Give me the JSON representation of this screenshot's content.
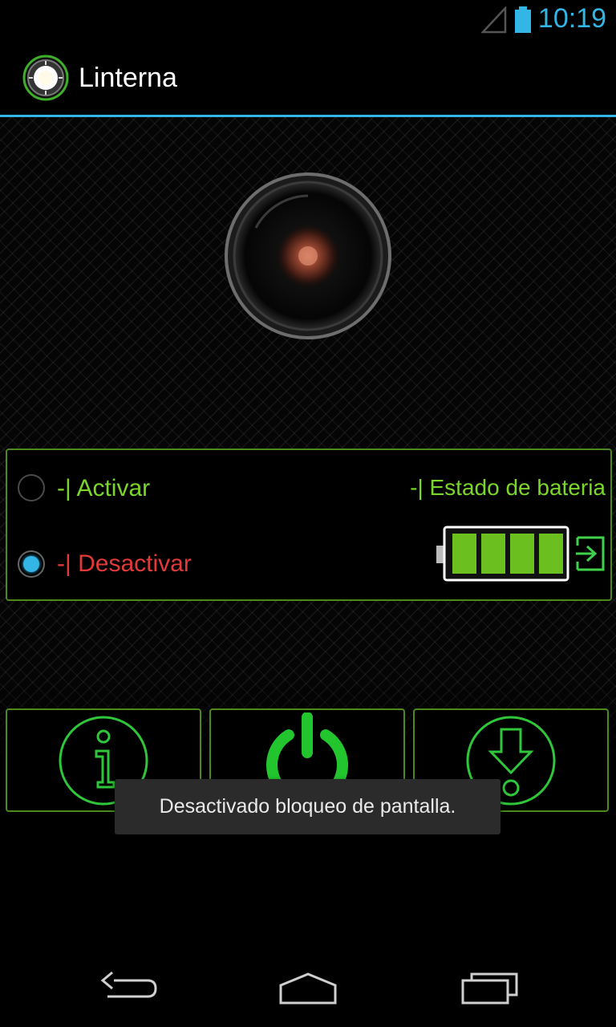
{
  "status_bar": {
    "time": "10:19",
    "signal_icon": "signal-icon",
    "battery_icon": "battery-icon"
  },
  "app_bar": {
    "title": "Linterna",
    "icon": "flashlight-app-icon"
  },
  "lens": {
    "icon": "camera-lens-icon"
  },
  "controls": {
    "activar_label": "-| Activar",
    "desactivar_label": "-| Desactivar",
    "selected": "desactivar",
    "battery_label": "-| Estado de bateria",
    "battery_level": 1.0
  },
  "buttons": [
    {
      "name": "info",
      "icon": "info-icon"
    },
    {
      "name": "power",
      "icon": "power-icon"
    },
    {
      "name": "download",
      "icon": "download-icon"
    }
  ],
  "toast": {
    "text": "Desactivado bloqueo de pantalla."
  },
  "nav": {
    "back_icon": "back-icon",
    "home_icon": "home-icon",
    "recent_icon": "recent-apps-icon"
  },
  "colors": {
    "accent_blue": "#33b5e5",
    "green": "#7bd62a",
    "red": "#e23a3a",
    "border_green": "#4b8a1a"
  }
}
